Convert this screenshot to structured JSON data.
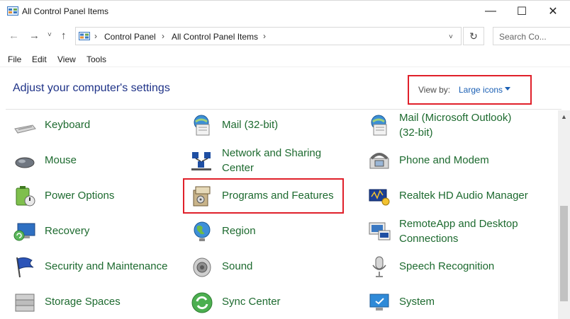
{
  "window": {
    "title": "All Control Panel Items",
    "minimize_glyph": "—",
    "maximize_glyph": "☐",
    "close_glyph": "✕"
  },
  "nav": {
    "back_glyph": "←",
    "forward_glyph": "→",
    "recent_glyph": "˅",
    "up_glyph": "↑",
    "breadcrumb": [
      "Control Panel",
      "All Control Panel Items"
    ],
    "separator": "›",
    "dropdown_glyph": "˅",
    "refresh_glyph": "↻",
    "search_placeholder": "Search Co..."
  },
  "menu": [
    "File",
    "Edit",
    "View",
    "Tools"
  ],
  "header": {
    "title": "Adjust your computer's settings",
    "view_by_label": "View by:",
    "view_by_value": "Large icons"
  },
  "items": {
    "col1": [
      {
        "label": "Keyboard",
        "icon": "keyboard-icon"
      },
      {
        "label": "Mouse",
        "icon": "mouse-icon"
      },
      {
        "label": "Power Options",
        "icon": "power-options-icon"
      },
      {
        "label": "Recovery",
        "icon": "recovery-icon"
      },
      {
        "label": "Security and Maintenance",
        "icon": "flag-icon"
      },
      {
        "label": "Storage Spaces",
        "icon": "storage-icon"
      }
    ],
    "col2": [
      {
        "label": "Mail (32-bit)",
        "icon": "mail-icon"
      },
      {
        "label_line1": "Network and Sharing",
        "label_line2": "Center",
        "icon": "network-icon"
      },
      {
        "label": "Programs and Features",
        "icon": "programs-icon"
      },
      {
        "label": "Region",
        "icon": "globe-icon"
      },
      {
        "label": "Sound",
        "icon": "speaker-icon"
      },
      {
        "label": "Sync Center",
        "icon": "sync-icon"
      }
    ],
    "col3": [
      {
        "label_line1": "Mail (Microsoft Outlook)",
        "label_line2": "(32-bit)",
        "icon": "mail-icon"
      },
      {
        "label": "Phone and Modem",
        "icon": "phone-icon"
      },
      {
        "label": "Realtek HD Audio Manager",
        "icon": "audio-icon"
      },
      {
        "label_line1": "RemoteApp and Desktop",
        "label_line2": "Connections",
        "icon": "remoteapp-icon"
      },
      {
        "label": "Speech Recognition",
        "icon": "microphone-icon"
      },
      {
        "label": "System",
        "icon": "system-icon"
      }
    ]
  },
  "colors": {
    "link_green": "#1d6a2f",
    "heading_blue": "#1e3287",
    "highlight_red": "#e0202a"
  }
}
